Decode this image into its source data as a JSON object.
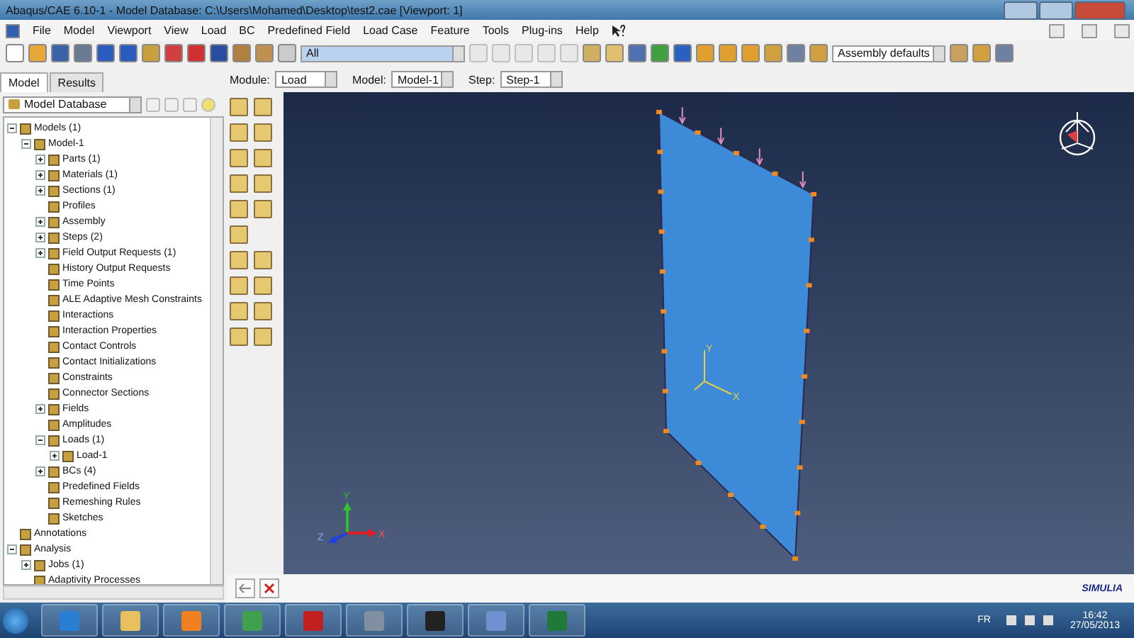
{
  "window": {
    "title": "Abaqus/CAE 6.10-1 - Model Database: C:\\Users\\Mohamed\\Desktop\\test2.cae [Viewport: 1]"
  },
  "menu": [
    "File",
    "Model",
    "Viewport",
    "View",
    "Load",
    "BC",
    "Predefined Field",
    "Load Case",
    "Feature",
    "Tools",
    "Plug-ins",
    "Help"
  ],
  "toolbar": {
    "selection_filter": "All",
    "render_style": "Assembly defaults"
  },
  "panel_tabs": [
    {
      "label": "Model",
      "selected": true
    },
    {
      "label": "Results",
      "selected": false
    }
  ],
  "context": [
    {
      "label": "Module:",
      "value": "Load"
    },
    {
      "label": "Model:",
      "value": "Model-1"
    },
    {
      "label": "Step:",
      "value": "Step-1"
    }
  ],
  "tree": {
    "source": "Model Database",
    "items": [
      {
        "label": "Models (1)",
        "kind": "branch",
        "expanded": true,
        "children": [
          {
            "label": "Model-1",
            "kind": "branch",
            "expanded": true,
            "children": [
              {
                "label": "Parts (1)",
                "kind": "branch",
                "expanded": false
              },
              {
                "label": "Materials (1)",
                "kind": "branch",
                "expanded": false
              },
              {
                "label": "Sections (1)",
                "kind": "branch",
                "expanded": false
              },
              {
                "label": "Profiles",
                "kind": "leaf"
              },
              {
                "label": "Assembly",
                "kind": "branch",
                "expanded": false
              },
              {
                "label": "Steps (2)",
                "kind": "branch",
                "expanded": false
              },
              {
                "label": "Field Output Requests (1)",
                "kind": "branch",
                "expanded": false
              },
              {
                "label": "History Output Requests",
                "kind": "leaf"
              },
              {
                "label": "Time Points",
                "kind": "leaf"
              },
              {
                "label": "ALE Adaptive Mesh Constraints",
                "kind": "leaf"
              },
              {
                "label": "Interactions",
                "kind": "leaf"
              },
              {
                "label": "Interaction Properties",
                "kind": "leaf"
              },
              {
                "label": "Contact Controls",
                "kind": "leaf"
              },
              {
                "label": "Contact Initializations",
                "kind": "leaf"
              },
              {
                "label": "Constraints",
                "kind": "leaf"
              },
              {
                "label": "Connector Sections",
                "kind": "leaf"
              },
              {
                "label": "Fields",
                "kind": "branch",
                "expanded": false
              },
              {
                "label": "Amplitudes",
                "kind": "leaf"
              },
              {
                "label": "Loads (1)",
                "kind": "branch",
                "expanded": true,
                "children": [
                  {
                    "label": "Load-1",
                    "kind": "branch",
                    "expanded": false
                  }
                ]
              },
              {
                "label": "BCs (4)",
                "kind": "branch",
                "expanded": false
              },
              {
                "label": "Predefined Fields",
                "kind": "leaf"
              },
              {
                "label": "Remeshing Rules",
                "kind": "leaf"
              },
              {
                "label": "Sketches",
                "kind": "leaf"
              }
            ]
          }
        ]
      },
      {
        "label": "Annotations",
        "kind": "leaf"
      },
      {
        "label": "Analysis",
        "kind": "branch",
        "expanded": true,
        "children": [
          {
            "label": "Jobs (1)",
            "kind": "branch",
            "expanded": false
          },
          {
            "label": "Adaptivity Processes",
            "kind": "leaf"
          }
        ]
      }
    ]
  },
  "viewport": {
    "triad_labels": [
      "Y",
      "X"
    ],
    "axis_labels": [
      "Y",
      "Z",
      "X"
    ]
  },
  "logo": "SIMULIA",
  "taskbar": {
    "language": "FR",
    "time": "16:42",
    "date": "27/05/2013"
  }
}
